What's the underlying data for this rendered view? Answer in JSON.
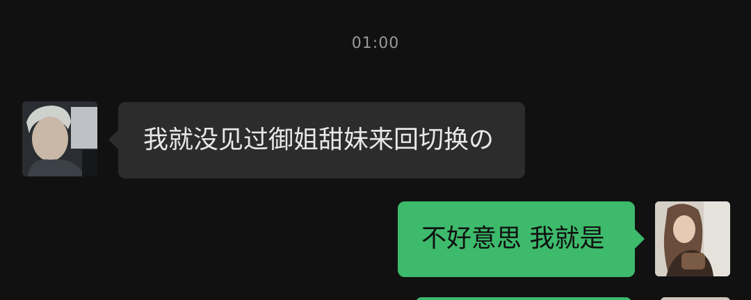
{
  "chat": {
    "timestamp": "01:00",
    "messages": [
      {
        "side": "left",
        "text": "我就没见过御姐甜妹来回切换の",
        "avatar_icon": "male-avatar-image"
      },
      {
        "side": "right",
        "text": "不好意思  我就是",
        "avatar_icon": "female-avatar-image"
      }
    ],
    "colors": {
      "background": "#111111",
      "incoming_bubble": "#2c2c2c",
      "outgoing_bubble": "#3dba6b",
      "timestamp_text": "#9a9a9a"
    }
  }
}
